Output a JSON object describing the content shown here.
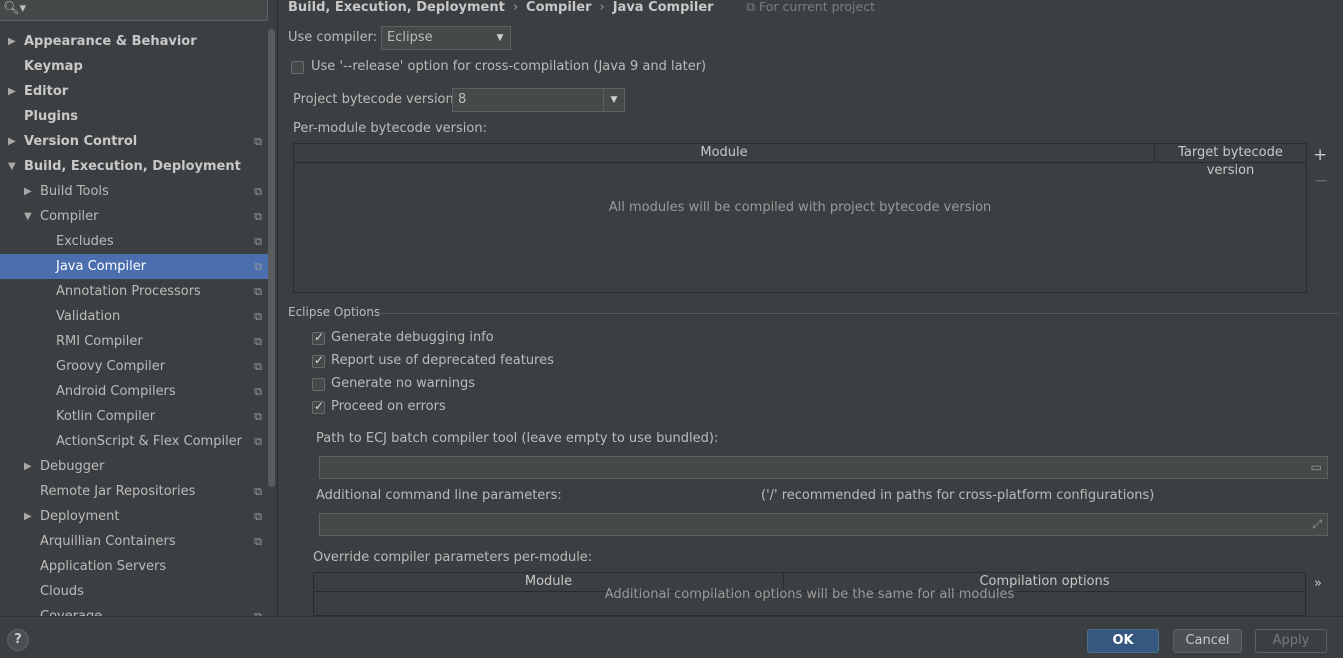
{
  "sidebar": {
    "search_icon": "search-icon",
    "items": [
      {
        "label": "Appearance & Behavior",
        "bold": true,
        "arrow": "right",
        "indent": 0
      },
      {
        "label": "Keymap",
        "bold": true,
        "arrow": "",
        "indent": 0
      },
      {
        "label": "Editor",
        "bold": true,
        "arrow": "right",
        "indent": 0
      },
      {
        "label": "Plugins",
        "bold": true,
        "arrow": "",
        "indent": 0
      },
      {
        "label": "Version Control",
        "bold": true,
        "arrow": "right",
        "indent": 0,
        "proj": true
      },
      {
        "label": "Build, Execution, Deployment",
        "bold": true,
        "arrow": "down",
        "indent": 0
      },
      {
        "label": "Build Tools",
        "bold": false,
        "arrow": "right",
        "indent": 1,
        "proj": true
      },
      {
        "label": "Compiler",
        "bold": false,
        "arrow": "down",
        "indent": 1,
        "proj": true
      },
      {
        "label": "Excludes",
        "bold": false,
        "arrow": "",
        "indent": 2,
        "proj": true
      },
      {
        "label": "Java Compiler",
        "bold": false,
        "arrow": "",
        "indent": 2,
        "proj": true,
        "selected": true
      },
      {
        "label": "Annotation Processors",
        "bold": false,
        "arrow": "",
        "indent": 2,
        "proj": true
      },
      {
        "label": "Validation",
        "bold": false,
        "arrow": "",
        "indent": 2,
        "proj": true
      },
      {
        "label": "RMI Compiler",
        "bold": false,
        "arrow": "",
        "indent": 2,
        "proj": true
      },
      {
        "label": "Groovy Compiler",
        "bold": false,
        "arrow": "",
        "indent": 2,
        "proj": true
      },
      {
        "label": "Android Compilers",
        "bold": false,
        "arrow": "",
        "indent": 2,
        "proj": true
      },
      {
        "label": "Kotlin Compiler",
        "bold": false,
        "arrow": "",
        "indent": 2,
        "proj": true
      },
      {
        "label": "ActionScript & Flex Compiler",
        "bold": false,
        "arrow": "",
        "indent": 2,
        "proj": true
      },
      {
        "label": "Debugger",
        "bold": false,
        "arrow": "right",
        "indent": 1
      },
      {
        "label": "Remote Jar Repositories",
        "bold": false,
        "arrow": "",
        "indent": 1,
        "proj": true
      },
      {
        "label": "Deployment",
        "bold": false,
        "arrow": "right",
        "indent": 1,
        "proj": true
      },
      {
        "label": "Arquillian Containers",
        "bold": false,
        "arrow": "",
        "indent": 1,
        "proj": true
      },
      {
        "label": "Application Servers",
        "bold": false,
        "arrow": "",
        "indent": 1
      },
      {
        "label": "Clouds",
        "bold": false,
        "arrow": "",
        "indent": 1
      },
      {
        "label": "Coverage",
        "bold": false,
        "arrow": "",
        "indent": 1,
        "proj": true
      }
    ]
  },
  "breadcrumb": {
    "parts": [
      "Build, Execution, Deployment",
      "Compiler",
      "Java Compiler"
    ],
    "separator": "›",
    "scope_label": "For current project"
  },
  "compiler": {
    "use_compiler_label": "Use compiler:",
    "use_compiler_value": "Eclipse",
    "release_option_label": "Use '--release' option for cross-compilation (Java 9 and later)",
    "release_option_checked": false,
    "bytecode_label": "Project bytecode version:",
    "bytecode_value": "8",
    "per_module_label": "Per-module bytecode version:",
    "module_table": {
      "columns": [
        "Module",
        "Target bytecode version"
      ],
      "empty_text": "All modules will be compiled with project bytecode version",
      "add_label": "+",
      "remove_label": "−"
    }
  },
  "eclipse_options": {
    "title": "Eclipse Options",
    "checkboxes": [
      {
        "label": "Generate debugging info",
        "checked": true
      },
      {
        "label": "Report use of deprecated features",
        "checked": true
      },
      {
        "label": "Generate no warnings",
        "checked": false
      },
      {
        "label": "Proceed on errors",
        "checked": true
      }
    ],
    "ecj_path_label": "Path to ECJ batch compiler tool (leave empty to use bundled):",
    "ecj_path_value": "",
    "cmd_params_label": "Additional command line parameters:",
    "cmd_params_hint": "('/' recommended in paths for cross-platform configurations)",
    "cmd_params_value": "",
    "override_label": "Override compiler parameters per-module:",
    "override_table": {
      "columns": [
        "Module",
        "Compilation options"
      ],
      "empty_text": "Additional compilation options will be the same for all modules",
      "more_label": "»"
    }
  },
  "footer": {
    "help_label": "?",
    "ok_label": "OK",
    "cancel_label": "Cancel",
    "apply_label": "Apply"
  },
  "colors": {
    "background": "#3c3f41",
    "selection": "#4b6eaf",
    "ok_button": "#365880"
  }
}
